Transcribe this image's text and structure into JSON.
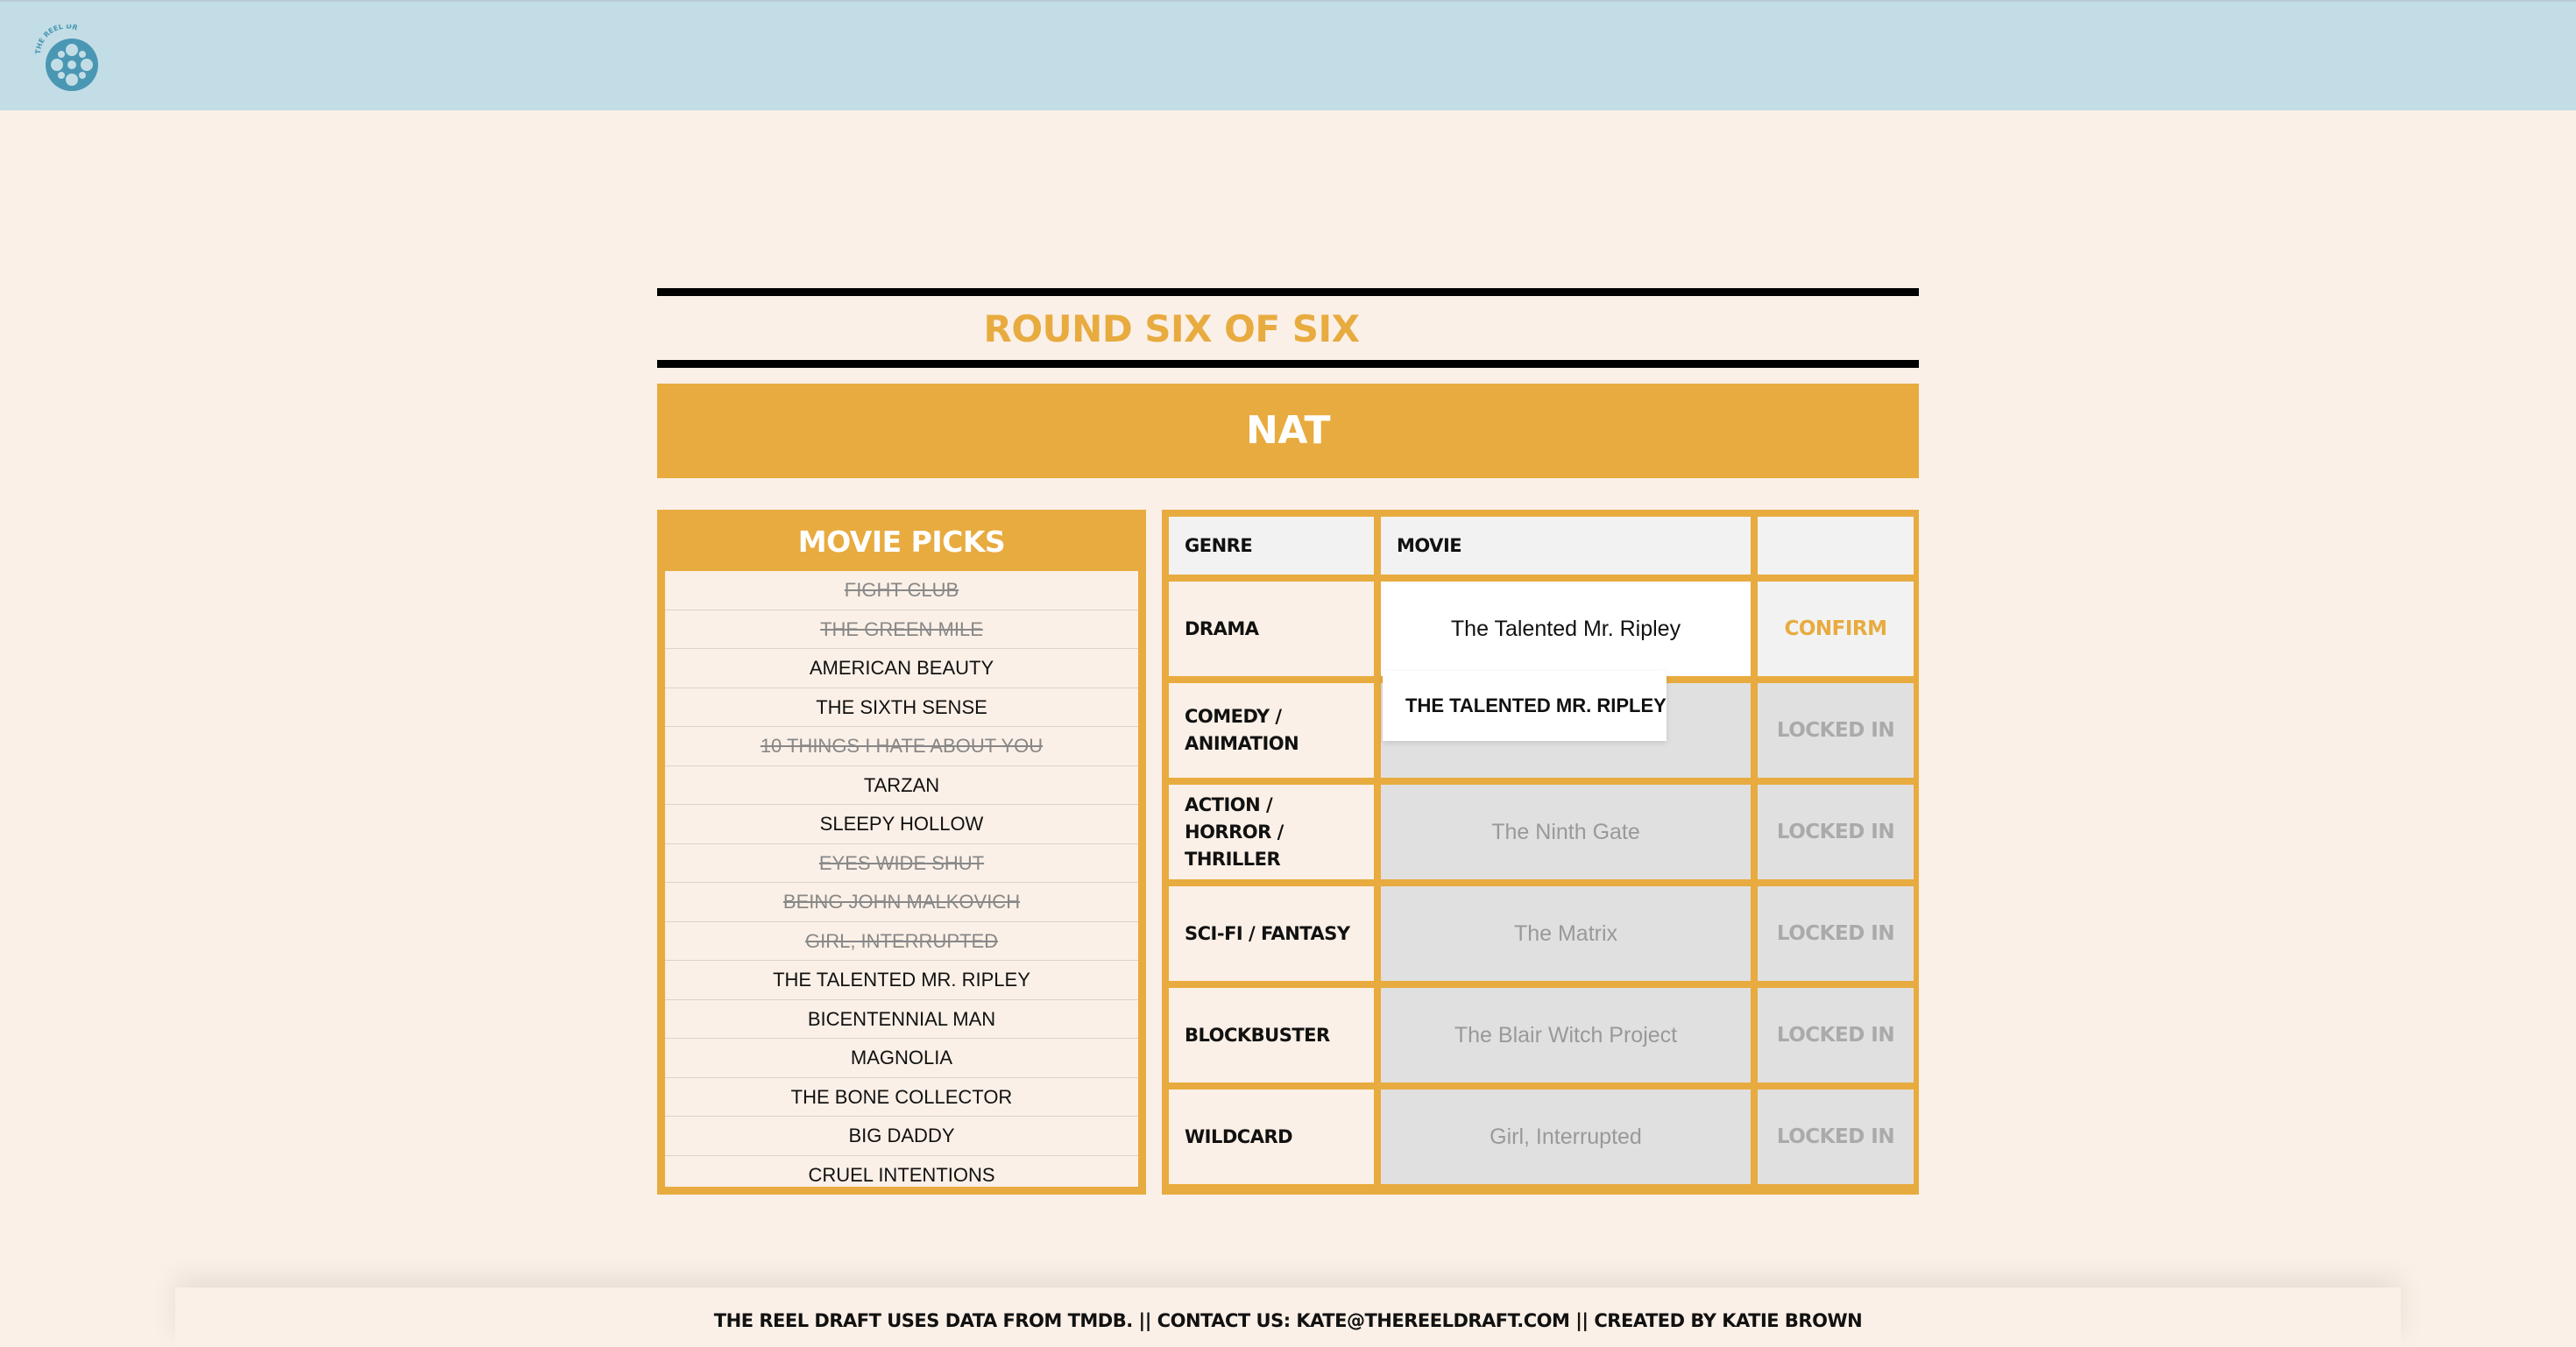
{
  "header": {
    "logo_icon": "film-reel-logo",
    "logo_text": "THE REEL DRAFT"
  },
  "round": {
    "title": "ROUND SIX OF SIX"
  },
  "player": {
    "name": "NAT"
  },
  "picks": {
    "title": "MOVIE PICKS",
    "items": [
      {
        "label": "Fight Club",
        "used": true
      },
      {
        "label": "The Green Mile",
        "used": true
      },
      {
        "label": "American Beauty",
        "used": false
      },
      {
        "label": "The Sixth Sense",
        "used": false
      },
      {
        "label": "10 Things I Hate About You",
        "used": true
      },
      {
        "label": "Tarzan",
        "used": false
      },
      {
        "label": "Sleepy Hollow",
        "used": false
      },
      {
        "label": "Eyes Wide Shut",
        "used": true
      },
      {
        "label": "Being John Malkovich",
        "used": true
      },
      {
        "label": "Girl, Interrupted",
        "used": true
      },
      {
        "label": "The Talented Mr. Ripley",
        "used": false
      },
      {
        "label": "Bicentennial Man",
        "used": false
      },
      {
        "label": "Magnolia",
        "used": false
      },
      {
        "label": "The Bone Collector",
        "used": false
      },
      {
        "label": "Big Daddy",
        "used": false
      },
      {
        "label": "Cruel Intentions",
        "used": false
      }
    ]
  },
  "table": {
    "headers": {
      "genre": "GENRE",
      "movie": "MOVIE",
      "action": ""
    },
    "rows": [
      {
        "genre": "DRAMA",
        "movie": "The Talented Mr. Ripley",
        "action": "CONFIRM",
        "locked": false
      },
      {
        "genre": "COMEDY / ANIMATION",
        "movie": "",
        "action": "LOCKED IN",
        "locked": true
      },
      {
        "genre": "ACTION / HORROR / THRILLER",
        "movie": "The Ninth Gate",
        "action": "LOCKED IN",
        "locked": true
      },
      {
        "genre": "SCI-FI / FANTASY",
        "movie": "The Matrix",
        "action": "LOCKED IN",
        "locked": true
      },
      {
        "genre": "BLOCKBUSTER",
        "movie": "The Blair Witch Project",
        "action": "LOCKED IN",
        "locked": true
      },
      {
        "genre": "WILDCARD",
        "movie": "Girl, Interrupted",
        "action": "LOCKED IN",
        "locked": true
      }
    ]
  },
  "suggestion": {
    "label": "The Talented Mr. Ripley"
  },
  "footer": {
    "text": "THE REEL DRAFT USES DATA FROM TMDB. || CONTACT US: KATE@THEREELDRAFT.COM || CREATED BY KATIE BROWN"
  },
  "colors": {
    "accent": "#e8ab3f",
    "header_bg": "#c3dde6",
    "page_bg": "#fbf0e7",
    "logo": "#4a97b4"
  }
}
